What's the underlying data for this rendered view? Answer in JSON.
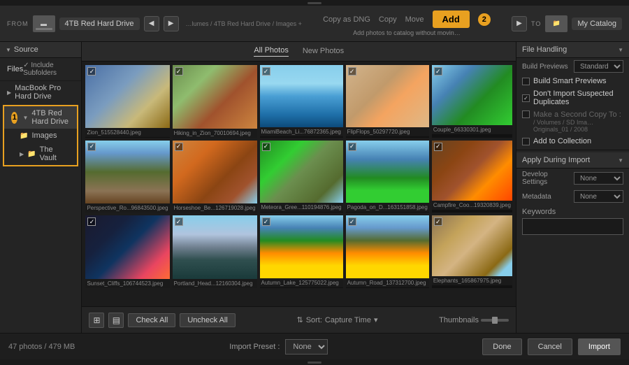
{
  "topbar": {
    "from_label": "FROM",
    "to_label": "TO",
    "from_drive": "4TB Red Hard Drive",
    "to_catalog": "My Catalog",
    "path_text": "…lumes / 4TB Red Hard Drive / Images +",
    "import_options": [
      "Copy as DNG",
      "Copy",
      "Move",
      "Add"
    ],
    "add_label": "Add",
    "add_subtext": "Add photos to catalog without movin…",
    "add_badge": "2"
  },
  "source": {
    "header": "Source",
    "files_label": "Files",
    "include_subfolders": "✓ Include Subfolders",
    "items": [
      {
        "label": "MacBook Pro Hard Drive",
        "indent": 0
      },
      {
        "label": "4TB Red Hard Drive",
        "indent": 0,
        "highlighted": true,
        "badge": "1"
      },
      {
        "label": "Images",
        "indent": 1
      },
      {
        "label": "The Vault",
        "indent": 1
      }
    ]
  },
  "photos": {
    "tabs": [
      "All Photos",
      "New Photos"
    ],
    "active_tab": "All Photos",
    "thumbnails": [
      {
        "filename": "Zion_515528440.jpeg",
        "thumb_class": "thumb-zion",
        "checked": true
      },
      {
        "filename": "Hiking_in_Zion_70010694.jpeg",
        "thumb_class": "thumb-hiking",
        "checked": true
      },
      {
        "filename": "MiamiBeach_Li...76872365.jpeg",
        "thumb_class": "thumb-miami",
        "checked": true
      },
      {
        "filename": "FlipFlops_50297720.jpeg",
        "thumb_class": "thumb-flipflops",
        "checked": true
      },
      {
        "filename": "Couple_66330301.jpeg",
        "thumb_class": "thumb-couple",
        "checked": true
      },
      {
        "filename": "Perspective_Ro...96843500.jpeg",
        "thumb_class": "thumb-perspective",
        "checked": true
      },
      {
        "filename": "Horseshoe_Be...126719028.jpeg",
        "thumb_class": "thumb-horseshoe",
        "checked": true
      },
      {
        "filename": "Meteora_Gree...110194876.jpeg",
        "thumb_class": "thumb-meteora",
        "checked": true
      },
      {
        "filename": "Pagoda_on_D...163151858.jpeg",
        "thumb_class": "thumb-pagoda",
        "checked": true
      },
      {
        "filename": "Campfire_Coo...19320839.jpeg",
        "thumb_class": "thumb-campfire",
        "checked": true
      },
      {
        "filename": "Sunset_Cliffs_106744523.jpeg",
        "thumb_class": "thumb-sunset",
        "checked": true
      },
      {
        "filename": "Portland_Head...12160304.jpeg",
        "thumb_class": "thumb-portland",
        "checked": true
      },
      {
        "filename": "Autumn_Lake_125775022.jpeg",
        "thumb_class": "thumb-autumn-lake",
        "checked": true
      },
      {
        "filename": "Autumn_Road_137312700.jpeg",
        "thumb_class": "thumb-autumn-road",
        "checked": true
      },
      {
        "filename": "Elephants_165867975.jpeg",
        "thumb_class": "thumb-elephants",
        "checked": true
      }
    ],
    "check_all": "Check All",
    "uncheck_all": "Uncheck All",
    "sort_label": "Sort:",
    "sort_value": "Capture Time",
    "thumbnails_label": "Thumbnails"
  },
  "file_handling": {
    "header": "File Handling",
    "build_previews_label": "Build Previews",
    "build_previews_value": "Standard",
    "build_smart_previews_label": "Build Smart Previews",
    "dont_import_label": "Don't Import Suspected Duplicates",
    "dont_import_checked": true,
    "make_second_copy_label": "Make a Second Copy To :",
    "path_value": "/ Volumes / SD Ima…Originals_01 / 2008",
    "add_to_collection_label": "Add to Collection"
  },
  "apply_during_import": {
    "header": "Apply During Import",
    "develop_settings_label": "Develop Settings",
    "develop_settings_value": "None",
    "metadata_label": "Metadata",
    "metadata_value": "None",
    "keywords_label": "Keywords"
  },
  "footer": {
    "photos_count": "47 photos / 479 MB",
    "import_preset_label": "Import Preset :",
    "import_preset_value": "None",
    "done_label": "Done",
    "cancel_label": "Cancel",
    "import_label": "Import"
  }
}
